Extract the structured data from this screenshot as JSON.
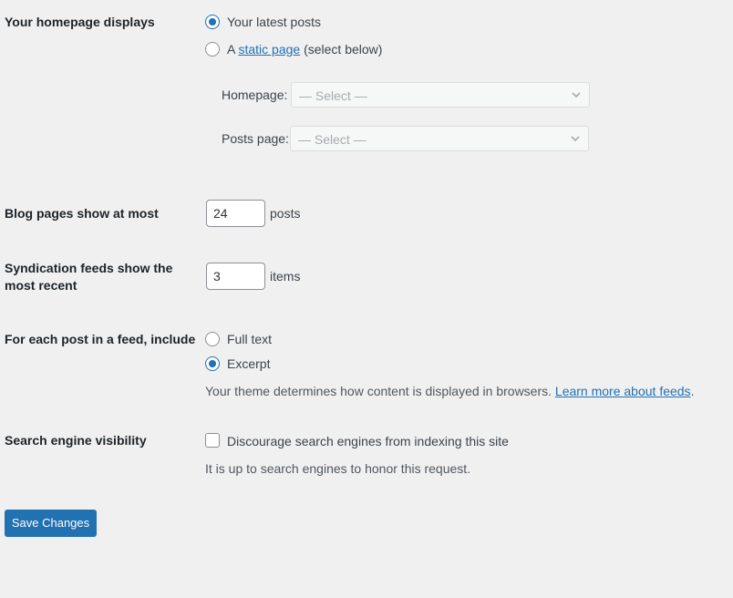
{
  "homepage": {
    "label": "Your homepage displays",
    "option_latest": "Your latest posts",
    "option_static_prefix": "A ",
    "option_static_link": "static page",
    "option_static_suffix": " (select below)",
    "homepage_select_label": "Homepage:",
    "homepage_select_value": "— Select —",
    "posts_select_label": "Posts page:",
    "posts_select_value": "— Select —",
    "selected": "latest"
  },
  "blog_pages": {
    "label": "Blog pages show at most",
    "value": "24",
    "unit": "posts"
  },
  "syndication": {
    "label_line1": "Syndication feeds show the",
    "label_line2": "most recent",
    "value": "3",
    "unit": "items"
  },
  "feed_content": {
    "label": "For each post in a feed, include",
    "option_full": "Full text",
    "option_excerpt": "Excerpt",
    "selected": "excerpt",
    "description": "Your theme determines how content is displayed in browsers. ",
    "learn_more": "Learn more about feeds",
    "period": "."
  },
  "search_visibility": {
    "label": "Search engine visibility",
    "checkbox_label": "Discourage search engines from indexing this site",
    "checked": false,
    "description": "It is up to search engines to honor this request."
  },
  "actions": {
    "save_label": "Save Changes"
  },
  "colors": {
    "accent": "#2271b1",
    "background": "#f0f0f1"
  }
}
